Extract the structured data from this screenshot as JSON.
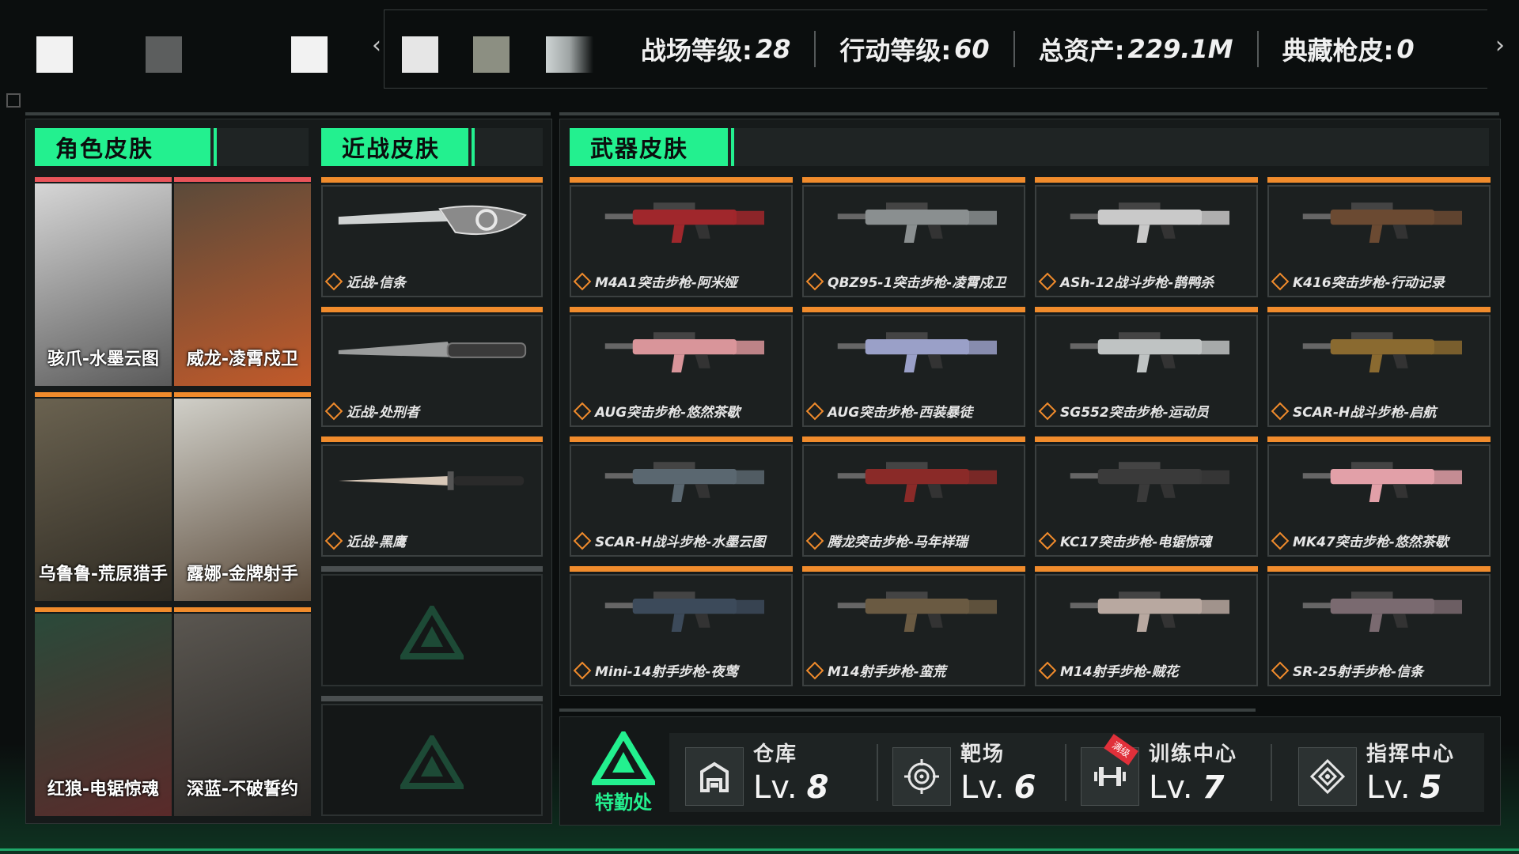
{
  "stats": [
    {
      "label": "战场等级:",
      "value": "28"
    },
    {
      "label": "行动等级:",
      "value": "60"
    },
    {
      "label": "总资产:",
      "value": "229.1M"
    },
    {
      "label": "典藏枪皮:",
      "value": "0"
    }
  ],
  "nav": {
    "prev": "‹",
    "next": "›"
  },
  "tabs": {
    "character": "角色皮肤",
    "melee": "近战皮肤",
    "weapon": "武器皮肤"
  },
  "characters": [
    {
      "name": "骇爪-水墨云图",
      "bar": "#e8545a"
    },
    {
      "name": "威龙-凌霄戍卫",
      "bar": "#e8545a"
    },
    {
      "name": "乌鲁鲁-荒原猎手",
      "bar": "#f08b2c"
    },
    {
      "name": "露娜-金牌射手",
      "bar": "#f08b2c"
    },
    {
      "name": "红狼-电锯惊魂",
      "bar": "#f08b2c"
    },
    {
      "name": "深蓝-不破誓约",
      "bar": "#f08b2c"
    }
  ],
  "melee": [
    {
      "name": "近战-信条"
    },
    {
      "name": "近战-处刑者"
    },
    {
      "name": "近战-黑鹰"
    }
  ],
  "weapons": [
    {
      "name": "M4A1突击步枪-阿米娅",
      "color": "#a0272c"
    },
    {
      "name": "QBZ95-1突击步枪-凌霄戍卫",
      "color": "#8a8f90"
    },
    {
      "name": "ASh-12战斗步枪-鹊鸭杀",
      "color": "#c9c9c9"
    },
    {
      "name": "K416突击步枪-行动记录",
      "color": "#6b4a32"
    },
    {
      "name": "AUG突击步枪-悠然茶歇",
      "color": "#d9959a"
    },
    {
      "name": "AUG突击步枪-西装暴徒",
      "color": "#9aa0c8"
    },
    {
      "name": "SG552突击步枪-运动员",
      "color": "#bfc3c3"
    },
    {
      "name": "SCAR-H战斗步枪-启航",
      "color": "#8a6a30"
    },
    {
      "name": "SCAR-H战斗步枪-水墨云图",
      "color": "#5a6770"
    },
    {
      "name": "腾龙突击步枪-马年祥瑞",
      "color": "#8a2a28"
    },
    {
      "name": "KC17突击步枪-电锯惊魂",
      "color": "#3a3a3a"
    },
    {
      "name": "MK47突击步枪-悠然茶歇",
      "color": "#e2a0a8"
    },
    {
      "name": "Mini-14射手步枪-夜莺",
      "color": "#3c4a5a"
    },
    {
      "name": "M14射手步枪-蛮荒",
      "color": "#6a5a42"
    },
    {
      "name": "M14射手步枪-贼花",
      "color": "#b8a8a0"
    },
    {
      "name": "SR-25射手步枪-信条",
      "color": "#7a6a70"
    }
  ],
  "department": {
    "label": "特勤处"
  },
  "facilities": [
    {
      "name": "仓库",
      "lv_prefix": "Lv.",
      "level": "8",
      "icon": "warehouse-icon"
    },
    {
      "name": "靶场",
      "lv_prefix": "Lv.",
      "level": "6",
      "icon": "target-icon"
    },
    {
      "name": "训练中心",
      "lv_prefix": "Lv.",
      "level": "7",
      "icon": "dumbbell-icon",
      "badge": "满级"
    },
    {
      "name": "指挥中心",
      "lv_prefix": "Lv.",
      "level": "5",
      "icon": "command-icon"
    }
  ],
  "colors": {
    "accent": "#23f08f",
    "orange": "#f08b2c",
    "red": "#e8545a"
  }
}
